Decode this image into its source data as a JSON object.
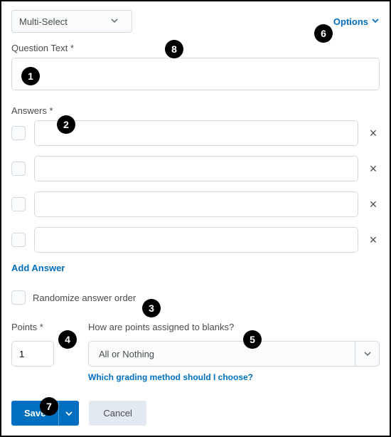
{
  "questionType": {
    "label": "Multi-Select"
  },
  "optionsLink": "Options",
  "questionText": {
    "label": "Question Text *",
    "value": ""
  },
  "answers": {
    "label": "Answers *",
    "rows": [
      {
        "value": ""
      },
      {
        "value": ""
      },
      {
        "value": ""
      },
      {
        "value": ""
      }
    ]
  },
  "addAnswer": "Add Answer",
  "randomize": {
    "label": "Randomize answer order"
  },
  "points": {
    "label": "Points *",
    "value": "1"
  },
  "grading": {
    "label": "How are points assigned to blanks?",
    "value": "All or Nothing",
    "help": "Which grading method should I choose?"
  },
  "buttons": {
    "save": "Save",
    "cancel": "Cancel"
  },
  "callouts": {
    "1": "1",
    "2": "2",
    "3": "3",
    "4": "4",
    "5": "5",
    "6": "6",
    "7": "7",
    "8": "8"
  }
}
